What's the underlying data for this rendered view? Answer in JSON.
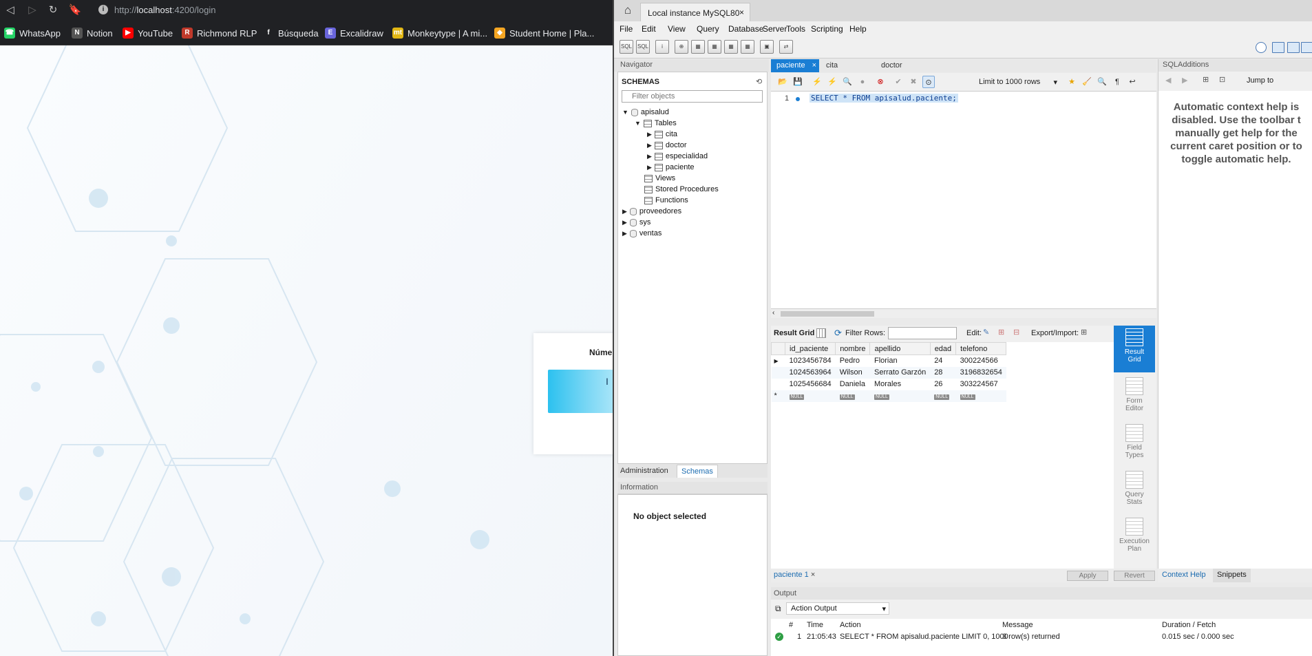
{
  "browser": {
    "url_prefix": "http://",
    "url_host": "localhost",
    "url_rest": ":4200/login",
    "bookmarks": [
      {
        "label": "WhatsApp",
        "color": "#25d366",
        "glyph": "☎"
      },
      {
        "label": "Notion",
        "color": "#555555",
        "glyph": "N"
      },
      {
        "label": "YouTube",
        "color": "#ff0000",
        "glyph": "▶"
      },
      {
        "label": "Richmond RLP",
        "color": "#c0392b",
        "glyph": "R"
      },
      {
        "label": "Búsqueda",
        "color": "#202124",
        "glyph": "f"
      },
      {
        "label": "Excalidraw",
        "color": "#6965db",
        "glyph": "E"
      },
      {
        "label": "Monkeytype | A mi...",
        "color": "#e2b714",
        "glyph": "mt"
      },
      {
        "label": "Student Home | Pla...",
        "color": "#f5a623",
        "glyph": "◆"
      }
    ],
    "login_label": "Númer",
    "login_button": "I"
  },
  "workbench": {
    "connection_tab": "Local instance MySQL80",
    "menu": [
      "File",
      "Edit",
      "View",
      "Query",
      "Database",
      "Server",
      "Tools",
      "Scripting",
      "Help"
    ],
    "navigator_title": "Navigator",
    "schemas_title": "SCHEMAS",
    "filter_placeholder": "Filter objects",
    "tree": {
      "db": "apisalud",
      "tables_label": "Tables",
      "tables": [
        "cita",
        "doctor",
        "especialidad",
        "paciente"
      ],
      "views": "Views",
      "procs": "Stored Procedures",
      "funcs": "Functions",
      "others": [
        "proveedores",
        "sys",
        "ventas"
      ]
    },
    "admin_tab": "Administration",
    "schemas_tab": "Schemas",
    "info_title": "Information",
    "no_object": "No object selected",
    "editor_tabs": [
      "paciente",
      "cita",
      "doctor"
    ],
    "limit": "Limit to 1000 rows",
    "line_no": "1",
    "sql": "SELECT * FROM apisalud.paciente;",
    "result_grid_label": "Result Grid",
    "filter_rows_label": "Filter Rows:",
    "edit_label": "Edit:",
    "export_label": "Export/Import:",
    "columns": [
      "id_paciente",
      "nombre",
      "apellido",
      "edad",
      "telefono"
    ],
    "rows": [
      [
        "1023456784",
        "Pedro",
        "Florian",
        "24",
        "300224566"
      ],
      [
        "1024563964",
        "Wilson",
        "Serrato Garzón",
        "28",
        "3196832654"
      ],
      [
        "1025456684",
        "Daniela",
        "Morales",
        "26",
        "303224567"
      ]
    ],
    "null_label": "NULL",
    "side_buttons": [
      {
        "l1": "Result",
        "l2": "Grid"
      },
      {
        "l1": "Form",
        "l2": "Editor"
      },
      {
        "l1": "Field",
        "l2": "Types"
      },
      {
        "l1": "Query",
        "l2": "Stats"
      },
      {
        "l1": "Execution",
        "l2": "Plan"
      }
    ],
    "result_tab": "paciente 1",
    "apply": "Apply",
    "revert": "Revert",
    "output_title": "Output",
    "output_mode": "Action Output",
    "output_cols": [
      "#",
      "Time",
      "Action",
      "Message",
      "Duration / Fetch"
    ],
    "output_row": {
      "n": "1",
      "time": "21:05:43",
      "action": "SELECT * FROM apisalud.paciente LIMIT 0, 1000",
      "message": "3 row(s) returned",
      "duration": "0.015 sec / 0.000 sec"
    },
    "sqladd_title": "SQLAdditions",
    "jump_to": "Jump to",
    "help_lines": [
      "Automatic context help is",
      "disabled. Use the toolbar t",
      "manually get help for the",
      "current caret position or to",
      "toggle automatic help."
    ],
    "context_help_tab": "Context Help",
    "snippets_tab": "Snippets"
  }
}
